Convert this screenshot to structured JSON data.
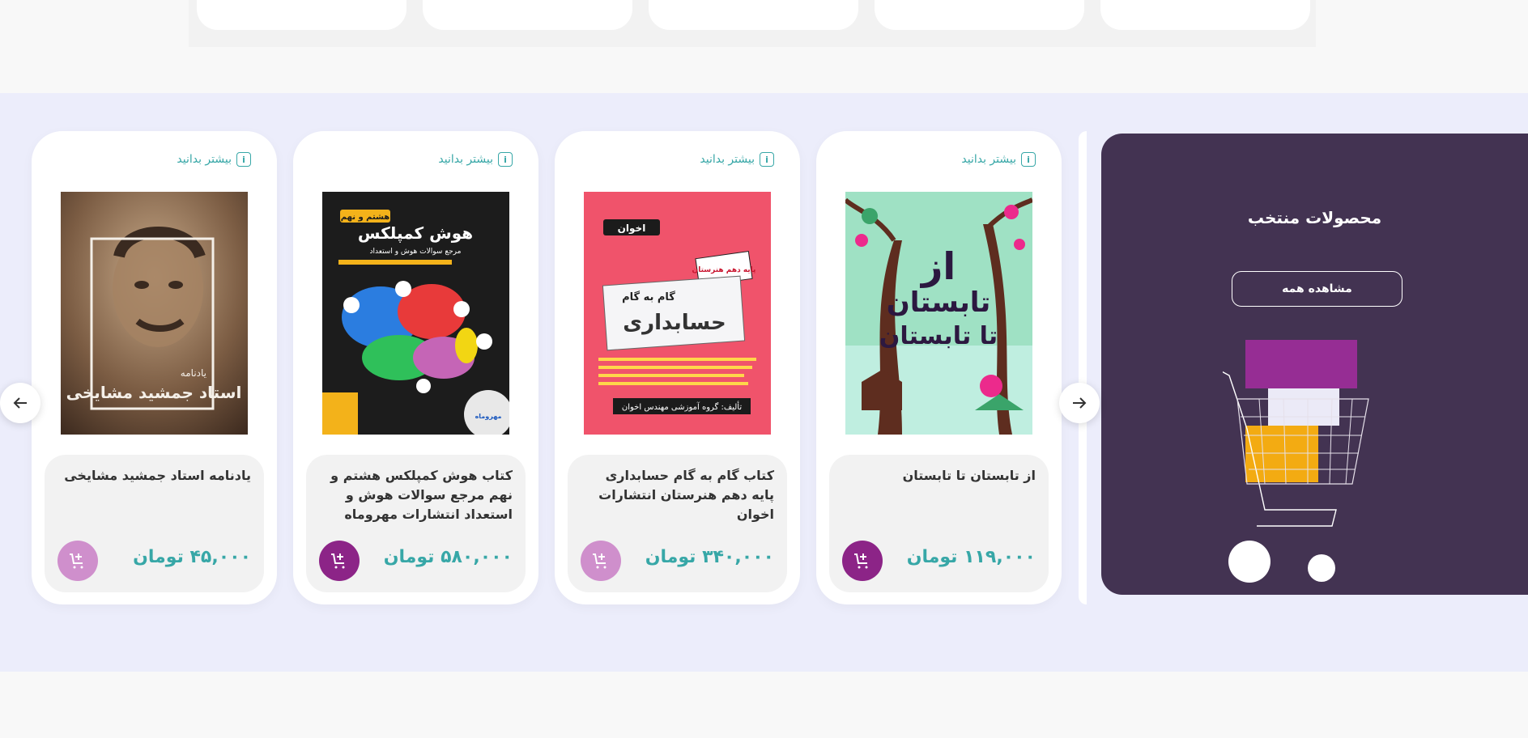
{
  "featured": {
    "title": "محصولات منتخب",
    "view_all_label": "مشاهده همه"
  },
  "colors": {
    "accent_teal": "#37a7a7",
    "promo_bg": "#433352",
    "cart_dark": "#8c2487",
    "cart_light": "#cf8fcc",
    "section_bg": "#ecedfb"
  },
  "products": [
    {
      "more_label": "بیشتر بدانید",
      "name": "از تابستان تا تابستان",
      "price": "۱۱۹,۰۰۰ تومان",
      "cover_title_1": "از",
      "cover_title_2": "تابستان",
      "cover_title_3": "تا تابستان"
    },
    {
      "more_label": "بیشتر بدانید",
      "name": "کتاب گام به گام حسابداری پایه دهم هنرستان انتشارات اخوان",
      "price": "۳۴۰,۰۰۰ تومان",
      "cover_publisher": "اخوان",
      "cover_badge": "پایه دهم هنرستان",
      "cover_subtitle": "گام به گام",
      "cover_title": "حسابداری",
      "cover_footer": "تألیف: گروه آموزشی مهندس اخوان"
    },
    {
      "more_label": "بیشتر بدانید",
      "name": "کتاب هوش کمپلکس هشتم و نهم مرجع سوالات هوش و استعداد انتشارات مهروماه",
      "price": "۵۸۰,۰۰۰ تومان",
      "cover_badge": "هشتم و نهم",
      "cover_title": "هوش کمپلکس",
      "cover_subtitle": "مرجع سوالات هوش و استعداد",
      "cover_publisher": "مهروماه"
    },
    {
      "more_label": "بیشتر بدانید",
      "name": "یادنامه استاد جمشید مشایخی",
      "price": "۴۵,۰۰۰ تومان",
      "cover_label": "یادنامه",
      "cover_title": "استاد جمشید مشایخی"
    }
  ]
}
